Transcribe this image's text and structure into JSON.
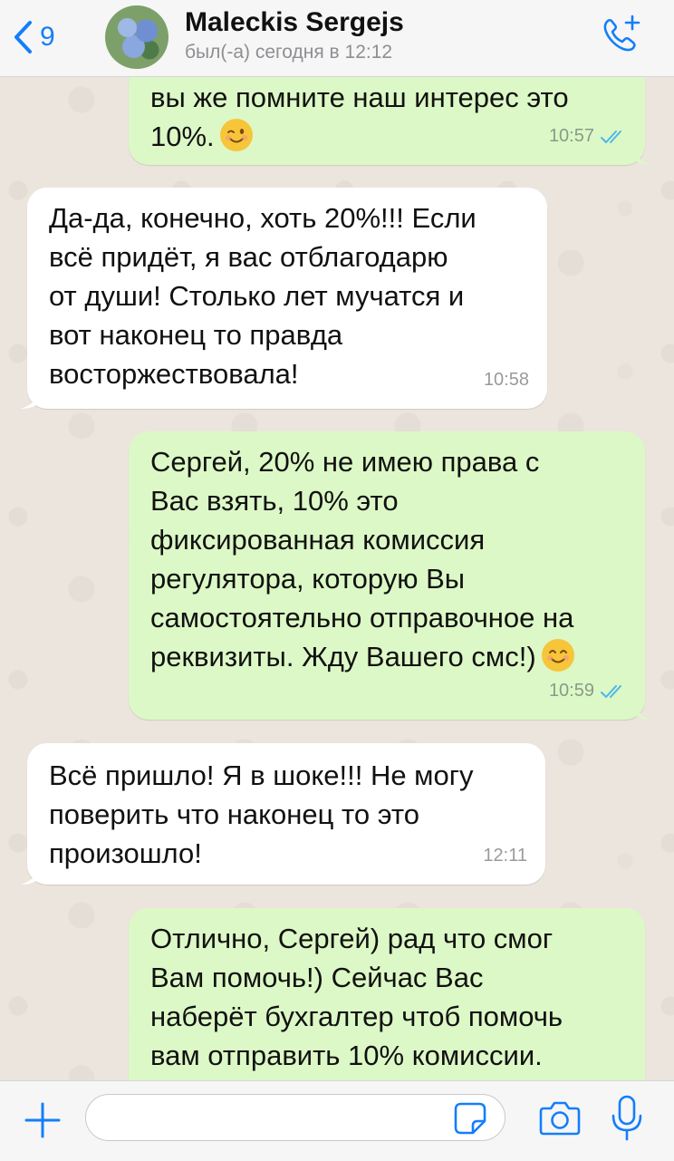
{
  "header": {
    "back_count": "9",
    "contact_name": "Maleckis Sergejs",
    "status": "был(-а) сегодня в 12:12"
  },
  "messages": [
    {
      "direction": "out",
      "text": "вы же помните наш интерес это\n10%.",
      "emoji": "winking-face",
      "time": "10:57",
      "read": true
    },
    {
      "direction": "in",
      "text": "Да-да, конечно, хоть 20%!!! Если\nвсё придёт, я вас отблагодарю\nот души! Столько лет мучатся и\nвот наконец то правда\nвосторжествовала!",
      "time": "10:58"
    },
    {
      "direction": "out",
      "text": "Сергей, 20% не имею права с\nВас взять, 10% это\nфиксированная комиссия\nрегулятора, которую Вы\nсамостоятельно отправочное на\nреквизиты. Жду Вашего смс!)",
      "emoji": "smiling-face",
      "time": "10:59",
      "read": true
    },
    {
      "direction": "in",
      "text": "Всё пришло! Я в шоке!!! Не могу\nповерить что наконец то это\nпроизошло!",
      "time": "12:11"
    },
    {
      "direction": "out",
      "text": "Отлично, Сергей) рад что смог\nВам помочь!) Сейчас Вас\nнаберёт бухгалтер чтоб помочь\nвам отправить 10% комиссии."
    }
  ],
  "input": {
    "value": "",
    "placeholder": ""
  },
  "colors": {
    "accent": "#147efb",
    "outgoing_bubble": "#dcf8c6",
    "incoming_bubble": "#ffffff",
    "read_ticks": "#4fb6ec"
  }
}
